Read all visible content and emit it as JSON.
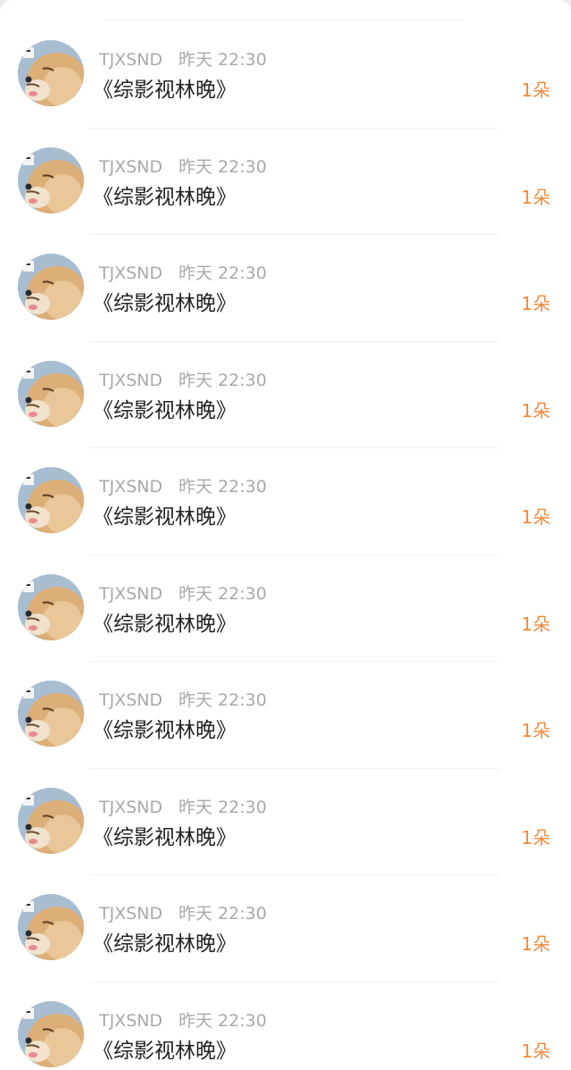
{
  "items": [
    {
      "username": "TJXSND",
      "time": "昨天 22:30",
      "title": "《综影视林晚》",
      "count": "1朵"
    },
    {
      "username": "TJXSND",
      "time": "昨天 22:30",
      "title": "《综影视林晚》",
      "count": "1朵"
    },
    {
      "username": "TJXSND",
      "time": "昨天 22:30",
      "title": "《综影视林晚》",
      "count": "1朵"
    },
    {
      "username": "TJXSND",
      "time": "昨天 22:30",
      "title": "《综影视林晚》",
      "count": "1朵"
    },
    {
      "username": "TJXSND",
      "time": "昨天 22:30",
      "title": "《综影视林晚》",
      "count": "1朵"
    },
    {
      "username": "TJXSND",
      "time": "昨天 22:30",
      "title": "《综影视林晚》",
      "count": "1朵"
    },
    {
      "username": "TJXSND",
      "time": "昨天 22:30",
      "title": "《综影视林晚》",
      "count": "1朵"
    },
    {
      "username": "TJXSND",
      "time": "昨天 22:30",
      "title": "《综影视林晚》",
      "count": "1朵"
    },
    {
      "username": "TJXSND",
      "time": "昨天 22:30",
      "title": "《综影视林晚》",
      "count": "1朵"
    },
    {
      "username": "TJXSND",
      "time": "昨天 22:30",
      "title": "《综影视林晚》",
      "count": "1朵"
    }
  ],
  "colors": {
    "count_accent": "#f08a3c",
    "meta_text": "#a9a9a9",
    "title_text": "#222222"
  }
}
